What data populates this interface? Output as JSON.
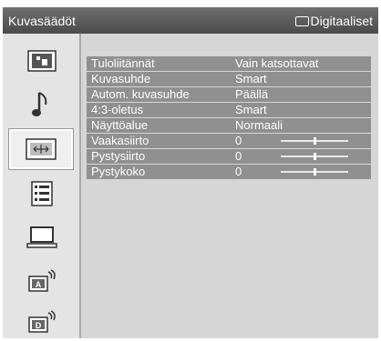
{
  "header": {
    "title": "Kuvasäädöt",
    "input_label": "Digitaaliset"
  },
  "sidebar": {
    "items": [
      {
        "name": "picture-settings-icon"
      },
      {
        "name": "sound-settings-icon"
      },
      {
        "name": "screen-settings-icon",
        "selected": true
      },
      {
        "name": "setup-list-icon"
      },
      {
        "name": "pc-settings-icon"
      },
      {
        "name": "analog-settings-icon",
        "letter": "A"
      },
      {
        "name": "digital-settings-icon",
        "letter": "D"
      }
    ]
  },
  "settings": [
    {
      "label": "Tuloliitännät",
      "value": "Vain katsottavat"
    },
    {
      "label": "Kuvasuhde",
      "value": "Smart"
    },
    {
      "label": "Autom. kuvasuhde",
      "value": "Päällä"
    },
    {
      "label": "4:3-oletus",
      "value": "Smart"
    },
    {
      "label": "Näyttöalue",
      "value": "Normaali"
    },
    {
      "label": "Vaakasiirto",
      "value": "0",
      "slider": 0.5
    },
    {
      "label": "Pystysiirto",
      "value": "0",
      "slider": 0.5
    },
    {
      "label": "Pystykoko",
      "value": "0",
      "slider": 0.5
    }
  ]
}
